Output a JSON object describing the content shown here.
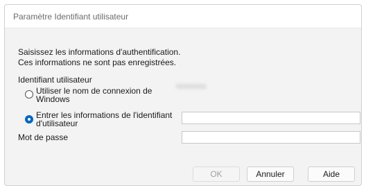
{
  "window": {
    "title": "Paramètre Identifiant utilisateur"
  },
  "intro": {
    "line1": "Saisissez les informations d'authentification.",
    "line2": "Ces informations ne sont pas enregistrées."
  },
  "user_id": {
    "label": "Identifiant utilisateur",
    "option_windows": {
      "line1": "Utiliser le nom de connexion de",
      "line2": "Windows",
      "checked": false,
      "value": "NNNNNN"
    },
    "option_enter": {
      "line1": "Entrer les informations de l'identifiant",
      "line2": "d'utilisateur",
      "checked": true,
      "value": ""
    }
  },
  "password": {
    "label": "Mot de passe",
    "value": ""
  },
  "buttons": {
    "ok": "OK",
    "cancel": "Annuler",
    "help": "Aide"
  },
  "colors": {
    "accent": "#0067c0"
  }
}
